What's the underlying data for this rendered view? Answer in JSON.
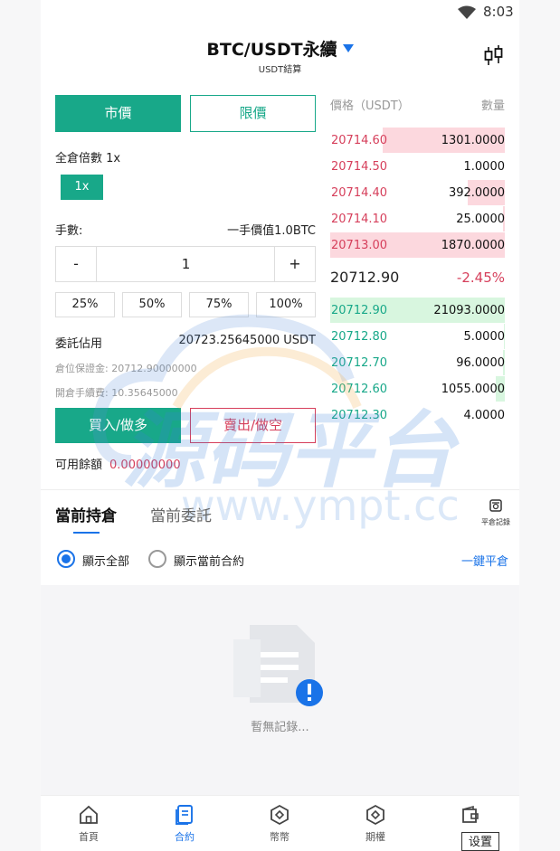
{
  "status": {
    "time": "8:03"
  },
  "header": {
    "title": "BTC/USDT永續",
    "subtitle": "USDT結算"
  },
  "order_type": {
    "market": "市價",
    "limit": "限價"
  },
  "leverage": {
    "label": "全倉倍數 1x",
    "button": "1x"
  },
  "quantity": {
    "label": "手數:",
    "unit_value": "一手價值1.0BTC",
    "value": "1",
    "minus": "-",
    "plus": "+"
  },
  "percents": [
    "25%",
    "50%",
    "75%",
    "100%"
  ],
  "margin": {
    "label": "委託佔用",
    "value": "20723.25645000 USDT",
    "position_margin": "倉位保證金: 20712.90000000",
    "open_fee": "開倉手續費: 10.35645000"
  },
  "actions": {
    "buy": "買入/做多",
    "sell": "賣出/做空"
  },
  "available": {
    "label": "可用餘額",
    "value": "0.00000000"
  },
  "orderbook": {
    "price_header": "價格（USDT）",
    "qty_header": "數量",
    "asks": [
      {
        "price": "20714.60",
        "qty": "1301.0000",
        "depth": 0.7
      },
      {
        "price": "20714.50",
        "qty": "1.0000",
        "depth": 0.0
      },
      {
        "price": "20714.40",
        "qty": "392.0000",
        "depth": 0.21
      },
      {
        "price": "20714.10",
        "qty": "25.0000",
        "depth": 0.01
      },
      {
        "price": "20713.00",
        "qty": "1870.0000",
        "depth": 1.0
      }
    ],
    "last_price": "20712.90",
    "change": "-2.45%",
    "bids": [
      {
        "price": "20712.90",
        "qty": "21093.0000",
        "depth": 1.0
      },
      {
        "price": "20712.80",
        "qty": "5.0000",
        "depth": 0.005
      },
      {
        "price": "20712.70",
        "qty": "96.0000",
        "depth": 0.01
      },
      {
        "price": "20712.60",
        "qty": "1055.0000",
        "depth": 0.05
      },
      {
        "price": "20712.30",
        "qty": "4.0000",
        "depth": 0.0
      }
    ]
  },
  "positions": {
    "tab_holdings": "當前持倉",
    "tab_orders": "當前委託",
    "close_record": "平倉記錄",
    "show_all": "顯示全部",
    "show_current": "顯示當前合約",
    "close_all": "一鍵平倉",
    "empty": "暫無記錄..."
  },
  "tabbar": [
    {
      "label": "首頁",
      "icon": "home-icon"
    },
    {
      "label": "合約",
      "icon": "contract-icon"
    },
    {
      "label": "幣幣",
      "icon": "coin-icon"
    },
    {
      "label": "期權",
      "icon": "option-icon"
    },
    {
      "label": "",
      "icon": "wallet-icon"
    }
  ],
  "tooltip": "设置",
  "watermark": {
    "text": "源码平台",
    "url": "www.ympt.cc"
  },
  "colors": {
    "green": "#18a889",
    "red": "#d63f5b",
    "blue": "#1a73e8"
  }
}
